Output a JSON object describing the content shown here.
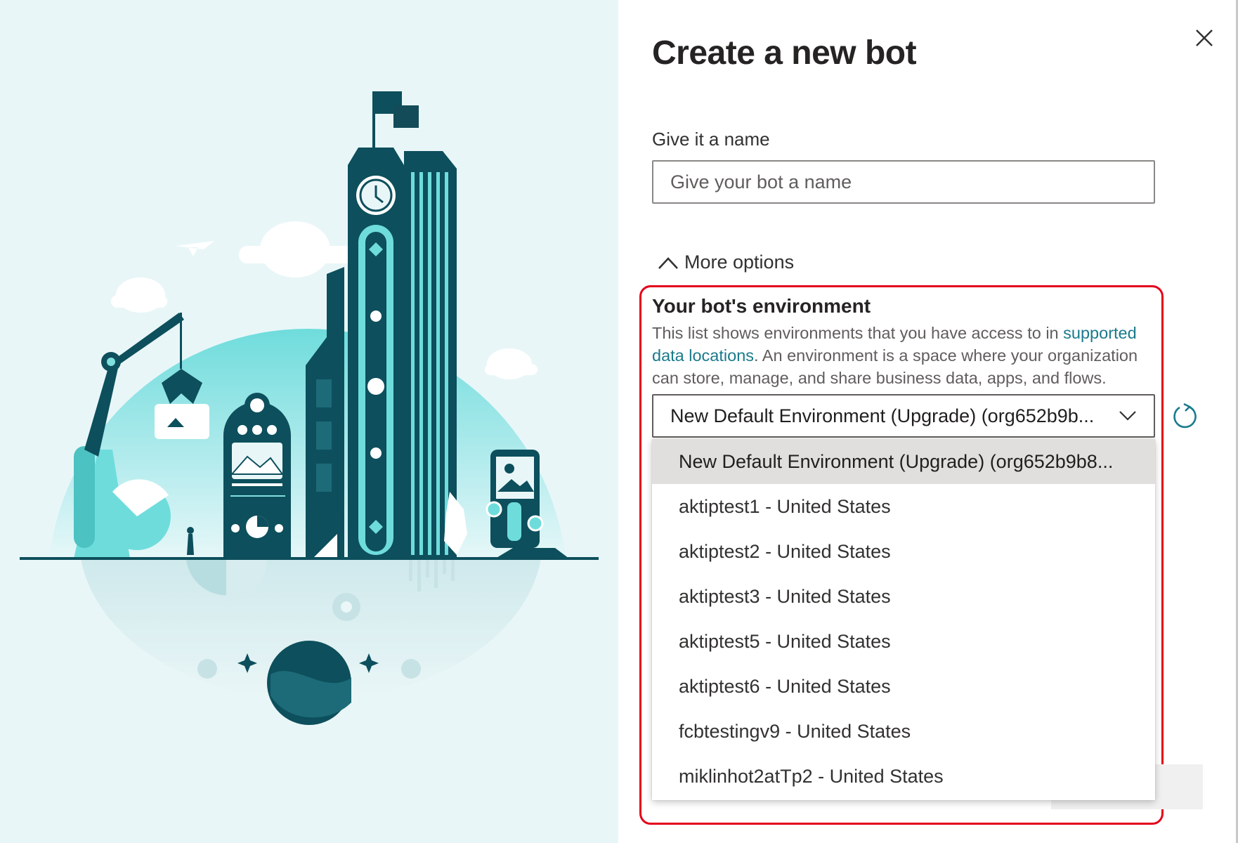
{
  "dialog": {
    "title": "Create a new bot",
    "name_label": "Give it a name",
    "name_placeholder": "Give your bot a name",
    "more_options_label": "More options",
    "environment": {
      "heading": "Your bot's environment",
      "desc_pre": "This list shows environments that you have access to in ",
      "desc_link": "supported data locations",
      "desc_post": ". An environment is a space where your organization can store, manage, and share business data, apps, and flows.",
      "selected_value": "New Default Environment (Upgrade) (org652b9b...",
      "options": [
        "New Default Environment (Upgrade) (org652b9b8...",
        "aktiptest1 - United States",
        "aktiptest2 - United States",
        "aktiptest3 - United States",
        "aktiptest5 - United States",
        "aktiptest6 - United States",
        "fcbtestingv9 - United States",
        "miklinhot2atTp2 - United States"
      ]
    }
  },
  "colors": {
    "highlight_border": "#e3001b",
    "teal_dark": "#0d4f5c",
    "teal_light": "#7fe0de",
    "link": "#1a7a8c"
  },
  "icons": [
    "close-icon",
    "chevron-up-icon",
    "chevron-down-icon",
    "refresh-icon"
  ]
}
